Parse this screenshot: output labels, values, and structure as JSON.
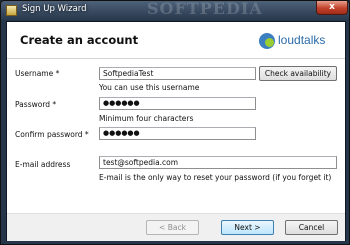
{
  "window": {
    "title": "Sign Up Wizard",
    "watermark": "SOFTPEDIA",
    "close_label": "x"
  },
  "header": {
    "heading": "Create an account",
    "logo_text": "loudtalks"
  },
  "form": {
    "username": {
      "label": "Username *",
      "value": "SoftpediaTest",
      "hint": "You can use this username",
      "check_label": "Check availability"
    },
    "password": {
      "label": "Password *",
      "value": "●●●●●●",
      "hint": "Minimum four characters"
    },
    "confirm": {
      "label": "Confirm password *",
      "value": "●●●●●●"
    },
    "email": {
      "label": "E-mail address",
      "value": "test@softpedia.com",
      "hint": "E-mail is the only way to reset your password (if you forget it)"
    }
  },
  "footer": {
    "back_label": "< Back",
    "next_label": "Next >",
    "cancel_label": "Cancel"
  },
  "colors": {
    "title_bar": "#26364a",
    "logo_blue": "#2b6aa8",
    "logo_green": "#9acd32",
    "close_red": "#c2422b"
  }
}
